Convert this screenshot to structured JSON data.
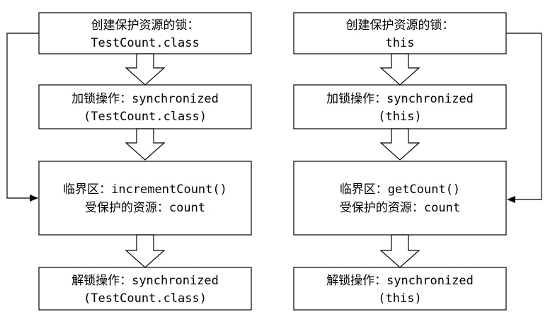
{
  "left": {
    "create_lock": {
      "line1": "创建保护资源的锁：",
      "line2": "TestCount.class"
    },
    "lock_op": {
      "line1": "加锁操作：synchronized",
      "line2": "(TestCount.class)"
    },
    "critical": {
      "line1": "临界区：incrementCount()",
      "line2": "受保护的资源：count"
    },
    "unlock_op": {
      "line1": "解锁操作：synchronized",
      "line2": "(TestCount.class)"
    }
  },
  "right": {
    "create_lock": {
      "line1": "创建保护资源的锁：",
      "line2": "this"
    },
    "lock_op": {
      "line1": "加锁操作：synchronized",
      "line2": "(this)"
    },
    "critical": {
      "line1": "临界区：getCount()",
      "line2": "受保护的资源：count"
    },
    "unlock_op": {
      "line1": "解锁操作：synchronized",
      "line2": "(this)"
    }
  }
}
